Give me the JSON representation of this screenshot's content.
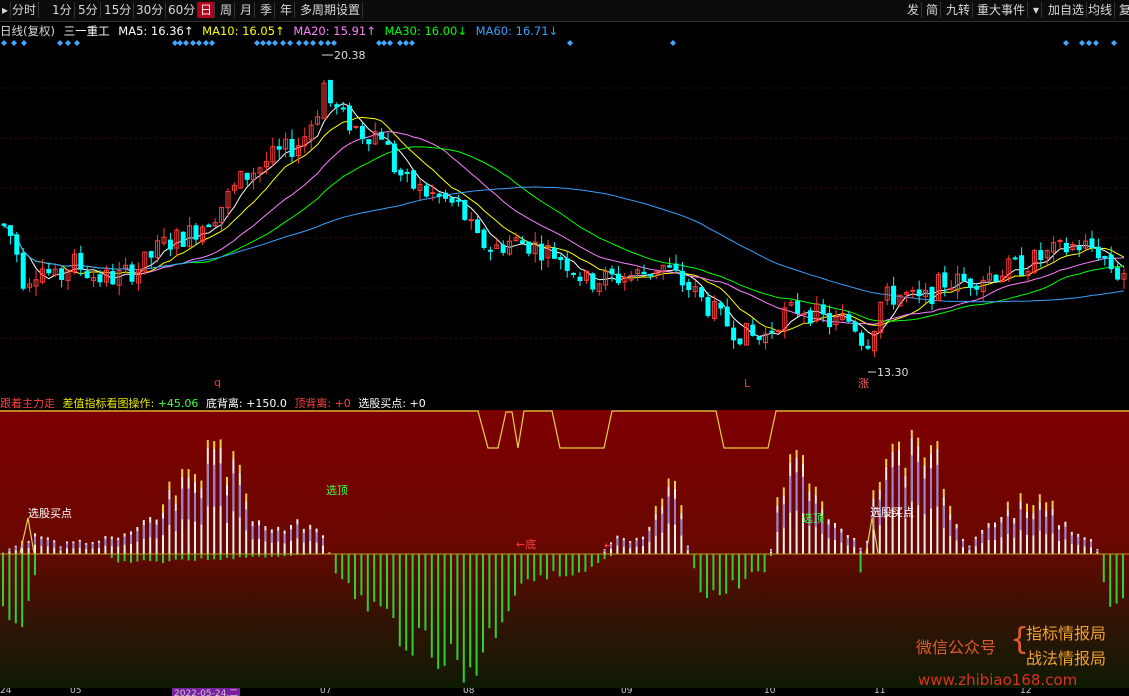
{
  "toolbar": {
    "left_items": [
      "分时",
      "1分",
      "5分",
      "15分",
      "30分",
      "60分",
      "日",
      "周",
      "月",
      "季",
      "年",
      "多周期",
      "设置"
    ],
    "active_item": "日",
    "right_items": [
      "发",
      "简",
      "九转",
      "重大事件",
      "▾",
      "加自选",
      "均线",
      "复"
    ]
  },
  "legend": {
    "period": "日线(复权)",
    "stock_name": "三一重工",
    "ma5": "MA5: 16.36↑",
    "ma10": "MA10: 16.05↑",
    "ma20": "MA20: 15.91↑",
    "ma30": "MA30: 16.00↓",
    "ma60": "MA60: 16.71↓"
  },
  "colors": {
    "up": "#ff3b3b",
    "down": "#00ffff",
    "ma5": "#ffffff",
    "ma10": "#ffff00",
    "ma20": "#ff80ff",
    "ma30": "#00ff00",
    "ma60": "#3aa0ff",
    "diamond": "#40a8ff",
    "label_red": "#ff3030"
  },
  "annotations": {
    "high": "20.38",
    "low": "13.30",
    "marker_q": "q",
    "marker_l": "L",
    "marker_zhang": "涨"
  },
  "indicator": {
    "name": "跟着主力走",
    "title": "差值指标看图操作:",
    "value": "+45.06",
    "di_label": "底背离:",
    "di_value": "+150.0",
    "top_label": "顶背离:",
    "top_value": "+0",
    "pick_label": "选股买点:",
    "pick_value": "+0",
    "labels": {
      "buy1": "选股买点",
      "top": "选顶",
      "bottom": "←底",
      "bottom2": "←",
      "buy2": "选股买点",
      "pick": "选顶"
    }
  },
  "dates": [
    "24",
    "05",
    "2022-05-24,二",
    "07",
    "08",
    "09",
    "10",
    "11",
    "12"
  ],
  "watermark": {
    "left": "微信公众号",
    "line1": "指标情报局",
    "line2": "战法情报局",
    "site": "www.zhibiao168.com"
  },
  "chart_data": {
    "type": "candlestick",
    "title": "三一重工",
    "period": "日线(复权)",
    "highest": 20.38,
    "lowest": 13.3,
    "moving_averages": [
      {
        "name": "MA5",
        "value": 16.36
      },
      {
        "name": "MA10",
        "value": 16.05
      },
      {
        "name": "MA20",
        "value": 15.91
      },
      {
        "name": "MA30",
        "value": 16.0
      },
      {
        "name": "MA60",
        "value": 16.71
      }
    ],
    "indicator": {
      "title": "差值指标看图操作",
      "value": 45.06,
      "bottom_divergence": 150.0,
      "top_divergence": 0,
      "pick_point": 0
    }
  }
}
